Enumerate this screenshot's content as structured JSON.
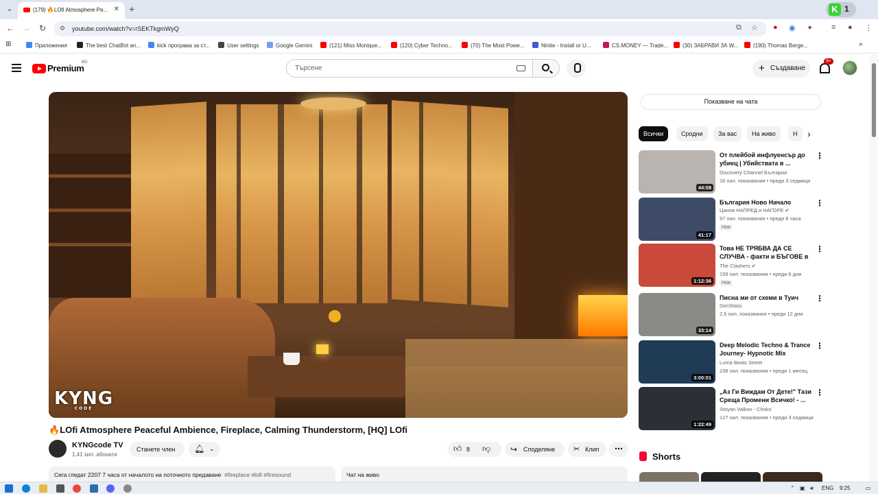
{
  "browser": {
    "tab_title": "(179) 🔥LOfi Atmosphere Pe...",
    "url": "youtube.com/watch?v=rSEKTkgmWyQ",
    "profile_count": "1",
    "bookmarks": [
      "Приложения",
      "The best ChatBot an...",
      "kick програма за ст...",
      "User settings",
      "Google Gemini",
      "(121) Miss Monique...",
      "(120) Cyber Techno...",
      "(70) The Most Powe...",
      "Ninite - Install or U...",
      "CS.MONEY — Trade...",
      "(30) ЗАБРАВИ ЗА W...",
      "(190) Thomas Berge..."
    ]
  },
  "header": {
    "logo_text": "Premium",
    "country_code": "BG",
    "search_placeholder": "Търсене",
    "create_label": "Създаване",
    "notif_badge": "9+"
  },
  "video": {
    "watermark": "KYNG",
    "watermark_sub": "CODE",
    "title_flame": "🔥",
    "title": "LOfi Atmosphere Peaceful Ambience, Fireplace, Calming Thunderstorm, [HQ] LOfi",
    "channel": "KYNGcode TV",
    "subscribers": "1,41 хил. абонати",
    "join_label": "Станете член",
    "likes": "8",
    "share_label": "Споделяне",
    "clip_label": "Клип",
    "description": "Сега гледат 2207  7 часа от началото на поточното предаване",
    "tags": "#fireplace #lofi #firesound",
    "live_chat": "Чат на живо"
  },
  "sidebar": {
    "show_chat": "Показване на чата",
    "chips": [
      "Всички",
      "Сродни",
      "За вас",
      "На живо",
      "Н"
    ],
    "recommendations": [
      {
        "title": "От плейбой инфлуенсър до убиец | Убийствата в ...",
        "channel": "Discovery Channel България",
        "meta": "16 хил. показвания • преди 3 седмици",
        "duration": "44:08",
        "is_new": false,
        "thumb": "#b9b4b0"
      },
      {
        "title": "България Ново Начало",
        "channel": "Цанов НАПРЕД и НАГОРЕ ✔",
        "meta": "97 хил. показвания • преди 8 часа",
        "duration": "41:17",
        "is_new": true,
        "thumb": "#3e4b67"
      },
      {
        "title": "Това НЕ ТРЯБВА ДА СЕ СЛУЧВА - факти и БЪГОВЕ в ...",
        "channel": "The Clashers ✔",
        "meta": "159 хил. показвания • преди 6 дни",
        "duration": "1:12:36",
        "is_new": true,
        "thumb": "#c94a3a"
      },
      {
        "title": "Писна ми от схеми в Туич",
        "channel": "DonStass",
        "meta": "2,5 хил. показвания • преди 12 дни",
        "duration": "33:14",
        "is_new": false,
        "thumb": "#8c8a86"
      },
      {
        "title": "Deep Melodic Techno & Trance Journey- Hypnotic Mix",
        "channel": "Luma Beats Street",
        "meta": "238 хил. показвания • преди 1 месец",
        "duration": "3:00:01",
        "is_new": false,
        "thumb": "#1f3b55"
      },
      {
        "title": "„Аз Ги Виждам От Дете!\" Тази Среща Промени Всичко! - ...",
        "channel": "Stoyan Valkov - Choko",
        "meta": "127 хил. показвания • преди 3 седмици",
        "duration": "1:22:49",
        "is_new": false,
        "thumb": "#2b2f36"
      }
    ],
    "new_label": "Нов",
    "shorts_label": "Shorts"
  },
  "taskbar": {
    "lang": "ENG",
    "time": "9:25"
  }
}
